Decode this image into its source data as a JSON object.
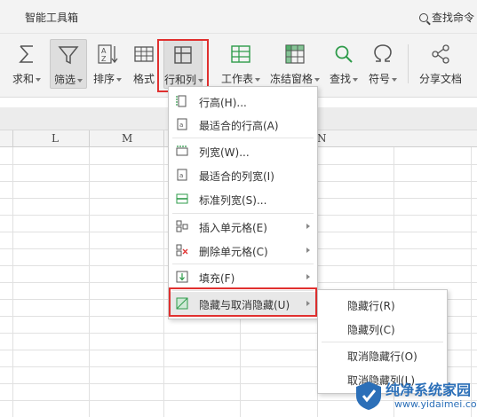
{
  "topbar": {
    "tab_title": "智能工具箱",
    "search_label": "查找命令"
  },
  "ribbon": {
    "sum_label": "求和",
    "filter_label": "筛选",
    "sort_label": "排序",
    "format_label": "格式",
    "rowcol_label": "行和列",
    "worksheet_label": "工作表",
    "freeze_label": "冻结窗格",
    "find_label": "查找",
    "symbol_label": "符号",
    "share_label": "分享文档"
  },
  "columns": [
    "L",
    "M",
    "N"
  ],
  "menu": {
    "items": [
      {
        "label": "行高(H)..."
      },
      {
        "label": "最适合的行高(A)"
      },
      {
        "label": "列宽(W)..."
      },
      {
        "label": "最适合的列宽(I)"
      },
      {
        "label": "标准列宽(S)..."
      },
      {
        "label": "插入单元格(E)"
      },
      {
        "label": "删除单元格(C)"
      },
      {
        "label": "填充(F)"
      },
      {
        "label": "隐藏与取消隐藏(U)"
      }
    ]
  },
  "submenu": {
    "items": [
      {
        "label": "隐藏行(R)"
      },
      {
        "label": "隐藏列(C)"
      },
      {
        "label": "取消隐藏行(O)"
      },
      {
        "label": "取消隐藏列(L)"
      }
    ]
  },
  "watermark": {
    "brand": "纯净系统家园",
    "url": "www.yidaimei.com"
  },
  "colors": {
    "highlight": "#e0302f",
    "accent_green": "#2e9b4a",
    "brand_blue": "#2b6fb8"
  }
}
